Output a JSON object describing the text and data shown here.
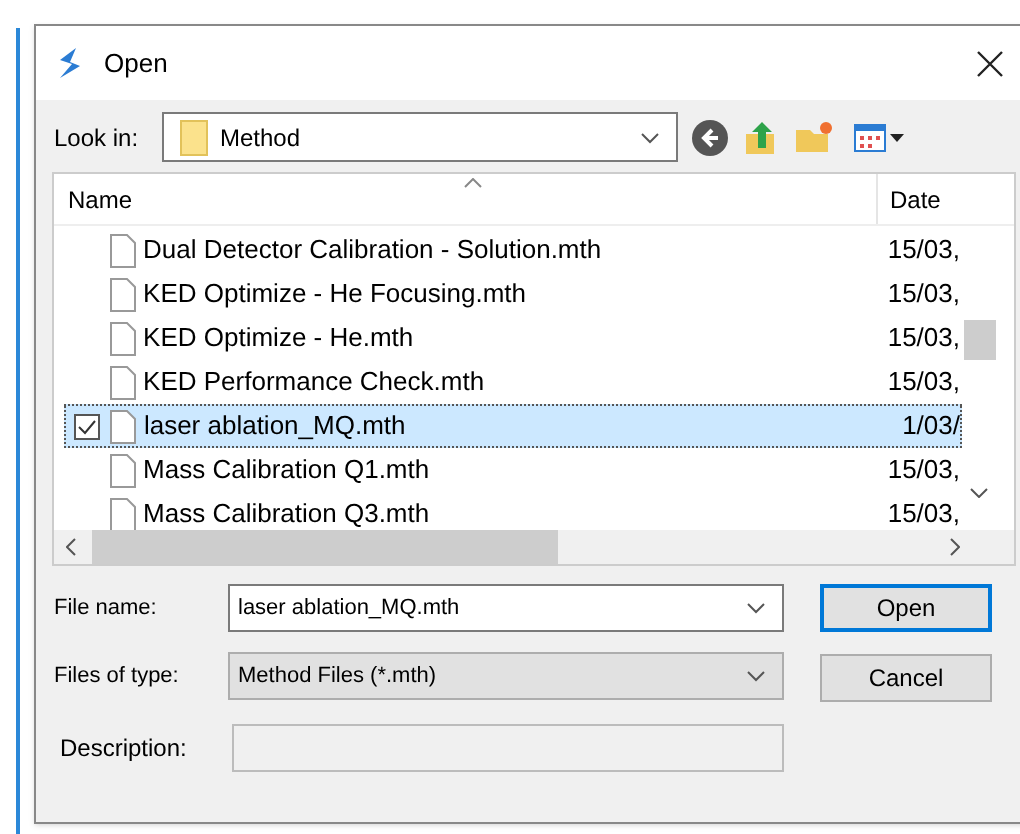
{
  "window": {
    "title": "Open"
  },
  "look_in": {
    "label": "Look in:",
    "value": "Method"
  },
  "file_list": {
    "columns": [
      "Name",
      "Date"
    ],
    "rows": [
      {
        "name": "Dual Detector Calibration - Solution.mth",
        "date": "15/03,",
        "selected": false,
        "checked": false
      },
      {
        "name": "KED Optimize - He Focusing.mth",
        "date": "15/03,",
        "selected": false,
        "checked": false
      },
      {
        "name": "KED Optimize - He.mth",
        "date": "15/03,",
        "selected": false,
        "checked": false
      },
      {
        "name": "KED Performance Check.mth",
        "date": "15/03,",
        "selected": false,
        "checked": false
      },
      {
        "name": "laser ablation_MQ.mth",
        "date": "1/03/",
        "selected": true,
        "checked": true
      },
      {
        "name": "Mass Calibration Q1.mth",
        "date": "15/03,",
        "selected": false,
        "checked": false
      },
      {
        "name": "Mass Calibration Q3.mth",
        "date": "15/03,",
        "selected": false,
        "checked": false
      }
    ]
  },
  "file_name": {
    "label": "File name:",
    "value": "laser ablation_MQ.mth"
  },
  "file_type": {
    "label": "Files of type:",
    "value": "Method Files (*.mth)"
  },
  "description": {
    "label": "Description:"
  },
  "buttons": [
    {
      "label": "Open",
      "default": true
    },
    {
      "label": "Cancel",
      "default": false
    }
  ]
}
